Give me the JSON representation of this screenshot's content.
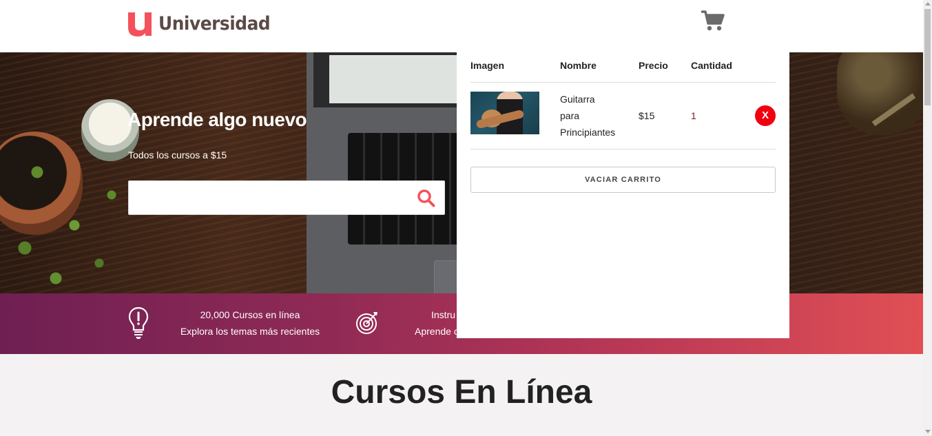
{
  "header": {
    "brand_text": "Universidad",
    "logo_letter": "u",
    "brand_color": "#f4525a"
  },
  "hero": {
    "title": "Aprende algo nuevo",
    "subtitle": "Todos los cursos a $15",
    "search": {
      "value": "",
      "placeholder": ""
    }
  },
  "features": [
    {
      "icon": "lightbulb-icon",
      "line1": "20,000 Cursos en línea",
      "line2": "Explora los temas más recientes"
    },
    {
      "icon": "target-icon",
      "line1": "Instru",
      "line2": "Aprende c"
    }
  ],
  "section": {
    "title": "Cursos En Línea"
  },
  "cart": {
    "headers": {
      "image": "Imagen",
      "name": "Nombre",
      "price": "Precio",
      "quantity": "Cantidad"
    },
    "items": [
      {
        "name_lines": [
          "Guitarra",
          "para",
          "Principiantes"
        ],
        "price": "$15",
        "quantity": "1",
        "remove_label": "X"
      }
    ],
    "empty_label": "VACIAR CARRITO"
  },
  "colors": {
    "accent": "#f4525a",
    "bar_start": "#6f1f53",
    "bar_end": "#e04f55",
    "remove": "#f2000f"
  }
}
